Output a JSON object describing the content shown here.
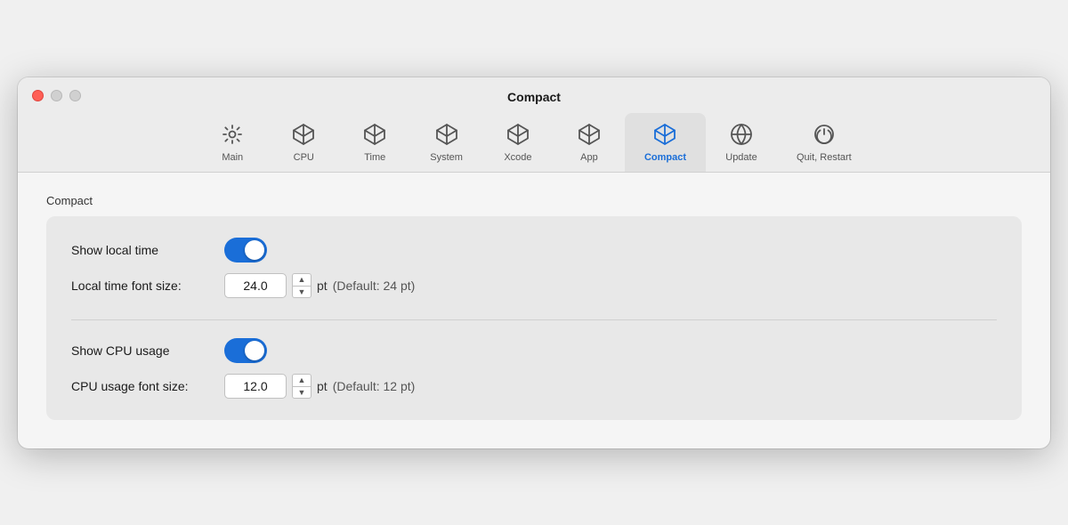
{
  "window": {
    "title": "Compact"
  },
  "toolbar": {
    "items": [
      {
        "id": "main",
        "label": "Main",
        "icon": "gear",
        "active": false
      },
      {
        "id": "cpu",
        "label": "CPU",
        "icon": "cube",
        "active": false
      },
      {
        "id": "time",
        "label": "Time",
        "icon": "cube",
        "active": false
      },
      {
        "id": "system",
        "label": "System",
        "icon": "cube",
        "active": false
      },
      {
        "id": "xcode",
        "label": "Xcode",
        "icon": "cube",
        "active": false
      },
      {
        "id": "app",
        "label": "App",
        "icon": "cube",
        "active": false
      },
      {
        "id": "compact",
        "label": "Compact",
        "icon": "cube-blue",
        "active": true
      },
      {
        "id": "update",
        "label": "Update",
        "icon": "globe",
        "active": false
      },
      {
        "id": "quit-restart",
        "label": "Quit, Restart",
        "icon": "power",
        "active": false
      }
    ]
  },
  "content": {
    "section_title": "Compact",
    "settings": {
      "show_local_time_label": "Show local time",
      "show_local_time_value": true,
      "local_time_font_size_label": "Local time font size:",
      "local_time_font_size_value": "24.0",
      "local_time_font_size_unit": "pt",
      "local_time_font_size_default": "(Default: 24 pt)",
      "show_cpu_usage_label": "Show CPU usage",
      "show_cpu_usage_value": true,
      "cpu_usage_font_size_label": "CPU usage font size:",
      "cpu_usage_font_size_value": "12.0",
      "cpu_usage_font_size_unit": "pt",
      "cpu_usage_font_size_default": "(Default: 12 pt)"
    }
  }
}
